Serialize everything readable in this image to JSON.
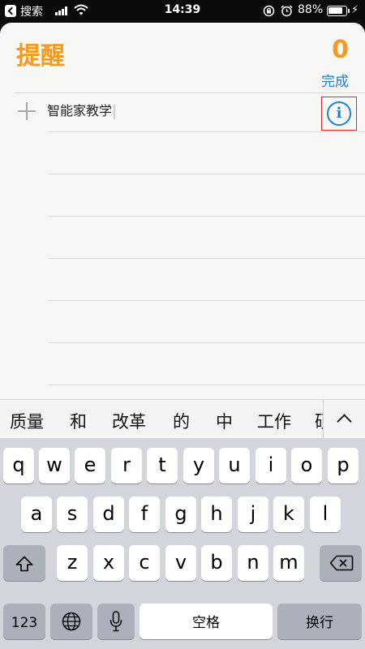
{
  "status_bar": {
    "back_label": "搜索",
    "time": "14:39",
    "battery_percent": "88%",
    "icons": [
      "back-arrow-icon",
      "signal-icon",
      "wifi-icon",
      "orientation-lock-icon",
      "alarm-icon",
      "battery-icon",
      "charging-bolt-icon"
    ]
  },
  "reminders": {
    "title": "提醒",
    "completed_count": "0",
    "done_label": "完成",
    "new_item_text": "智能家教学",
    "add_icon": "plus-icon",
    "info_icon": "info-icon",
    "info_glyph": "i",
    "accent_color": "#f39a1f",
    "link_color": "#1a82d6",
    "highlight_color": "#e02626"
  },
  "candidates": {
    "items": [
      "质量",
      "和",
      "改革",
      "的",
      "中",
      "工作",
      "硕"
    ],
    "collapse_icon": "chevron-up-icon"
  },
  "keyboard": {
    "row1": [
      "q",
      "w",
      "e",
      "r",
      "t",
      "y",
      "u",
      "i",
      "o",
      "p"
    ],
    "row2": [
      "a",
      "s",
      "d",
      "f",
      "g",
      "h",
      "j",
      "k",
      "l"
    ],
    "row3": [
      "z",
      "x",
      "c",
      "v",
      "b",
      "n",
      "m"
    ],
    "numbers_label": "123",
    "space_label": "空格",
    "return_label": "换行",
    "icons": [
      "shift-icon",
      "delete-icon",
      "globe-icon",
      "microphone-icon"
    ]
  }
}
